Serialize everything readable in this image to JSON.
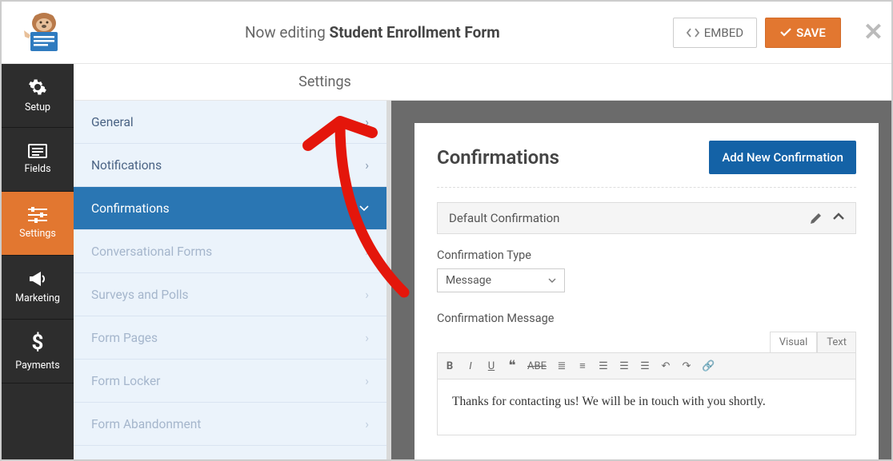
{
  "header": {
    "editing_prefix": "Now editing ",
    "form_name": "Student Enrollment Form",
    "embed_label": "EMBED",
    "save_label": "SAVE"
  },
  "leftbar": {
    "setup": "Setup",
    "fields": "Fields",
    "settings": "Settings",
    "marketing": "Marketing",
    "payments": "Payments"
  },
  "submenu": {
    "title": "Settings",
    "items": {
      "general": "General",
      "notifications": "Notifications",
      "confirmations": "Confirmations",
      "conversational": "Conversational Forms",
      "surveys": "Surveys and Polls",
      "formpages": "Form Pages",
      "formlocker": "Form Locker",
      "formabandon": "Form Abandonment"
    }
  },
  "panel": {
    "title": "Confirmations",
    "add_button": "Add New Confirmation",
    "accordion_title": "Default Confirmation",
    "type_label": "Confirmation Type",
    "type_value": "Message",
    "message_label": "Confirmation Message",
    "tabs": {
      "visual": "Visual",
      "text": "Text"
    },
    "message_body": "Thanks for contacting us! We will be in touch with you shortly."
  }
}
